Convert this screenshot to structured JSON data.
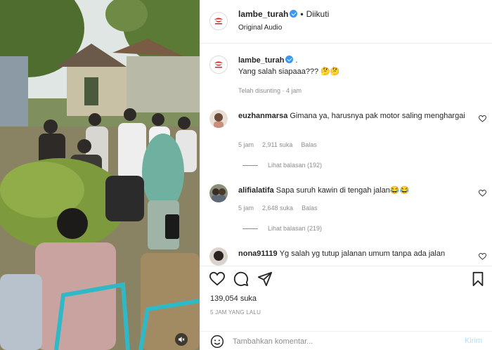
{
  "post_author": {
    "username": "lambe_turah",
    "follow_status": "Diikuti",
    "audio": "Original Audio",
    "separator": "•"
  },
  "caption": {
    "username": "lambe_turah",
    "trailing": ".",
    "text": "Yang salah siapaaa??? 🤔🤔",
    "meta": "Telah disunting · 4 jam"
  },
  "comments": [
    {
      "username": "euzhanmarsa",
      "text": "Gimana ya, harusnya pak motor saling menghargai",
      "time": "5 jam",
      "likes": "2,911 suka",
      "reply": "Balas",
      "view_replies": "Lihat balasan (192)"
    },
    {
      "username": "alifialatifa",
      "text": "Sapa suruh kawin di tengah jalan😂😂",
      "time": "5 jam",
      "likes": "2,648 suka",
      "reply": "Balas",
      "view_replies": "Lihat balasan (219)"
    },
    {
      "username": "nona91119",
      "text": "Yg salah yg tutup jalanan umum tanpa ada jalan"
    }
  ],
  "actions": {
    "icons": [
      "heart-icon",
      "comment-icon",
      "share-icon",
      "bookmark-icon"
    ],
    "likes": "139,054 suka",
    "posted": "5 JAM YANG LALU"
  },
  "comment_box": {
    "placeholder": "Tambahkan komentar...",
    "send": "Kirim"
  },
  "colors": {
    "brand_red": "#d0262c",
    "verified": "#3897f0",
    "muted_text": "#8e8e8e",
    "send_disabled": "#b2dffc"
  }
}
